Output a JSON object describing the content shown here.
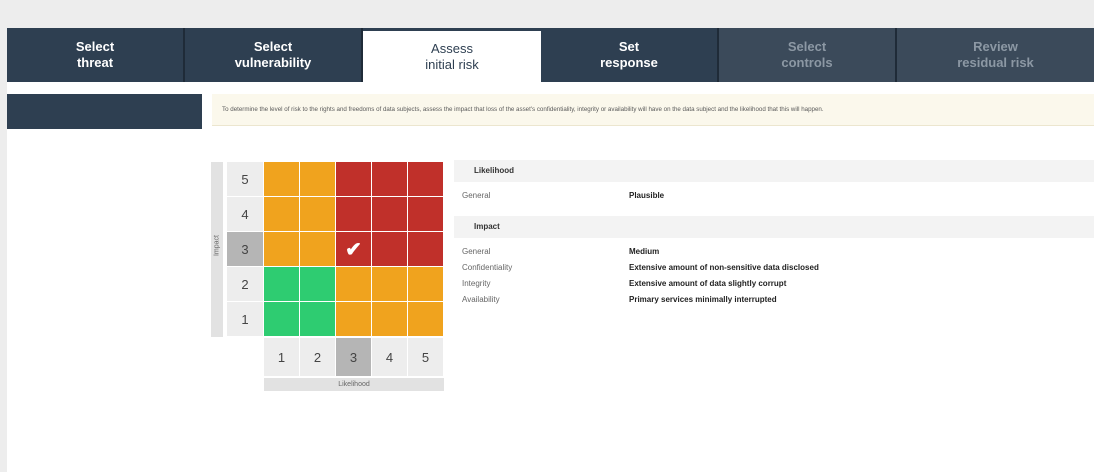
{
  "steps": [
    {
      "line1": "Select",
      "line2": "threat"
    },
    {
      "line1": "Select",
      "line2": "vulnerability"
    },
    {
      "line1": "Assess",
      "line2": "initial risk"
    },
    {
      "line1": "Set",
      "line2": "response"
    },
    {
      "line1": "Select",
      "line2": "controls"
    },
    {
      "line1": "Review",
      "line2": "residual risk"
    }
  ],
  "active_step": "Assess initial risk",
  "info_text": "To determine the level of risk to the rights and freedoms of data subjects, assess the impact that loss of the asset's confidentiality, integrity or availability will have on the data subject and the likelihood that this will happen.",
  "matrix": {
    "y_axis_label": "Impact",
    "x_axis_label": "Likelihood",
    "y_values": [
      "5",
      "4",
      "3",
      "2",
      "1"
    ],
    "x_values": [
      "1",
      "2",
      "3",
      "4",
      "5"
    ],
    "selected_impact": "3",
    "selected_likelihood": "3",
    "check_glyph": "✔",
    "colors": {
      "green": "#2ecc71",
      "orange": "#f0a31e",
      "red": "#c0302a"
    },
    "rows": [
      [
        "orange",
        "orange",
        "red",
        "red",
        "red"
      ],
      [
        "orange",
        "orange",
        "red",
        "red",
        "red"
      ],
      [
        "orange",
        "orange",
        "red",
        "red",
        "red"
      ],
      [
        "green",
        "green",
        "orange",
        "orange",
        "orange"
      ],
      [
        "green",
        "green",
        "orange",
        "orange",
        "orange"
      ]
    ]
  },
  "likelihood": {
    "heading": "Likelihood",
    "general_label": "General",
    "general_value": "Plausible"
  },
  "impact": {
    "heading": "Impact",
    "items": [
      {
        "label": "General",
        "value": "Medium"
      },
      {
        "label": "Confidentiality",
        "value": "Extensive amount of non-sensitive data disclosed"
      },
      {
        "label": "Integrity",
        "value": "Extensive amount of data slightly corrupt"
      },
      {
        "label": "Availability",
        "value": "Primary services minimally interrupted"
      }
    ]
  }
}
